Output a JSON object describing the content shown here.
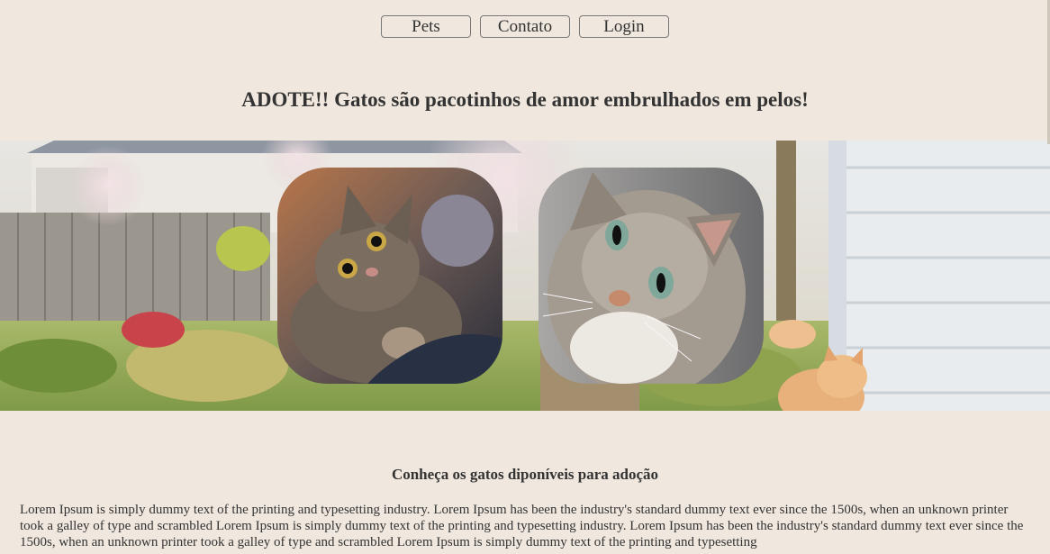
{
  "nav": {
    "items": [
      {
        "label": "Pets"
      },
      {
        "label": "Contato"
      },
      {
        "label": "Login"
      }
    ]
  },
  "hero": {
    "headline": "ADOTE!! Gatos são pacotinhos de amor embrulhados em pelos!"
  },
  "banner": {
    "images": [
      {
        "icon": "tabby-kitten-photo"
      },
      {
        "icon": "tabby-cat-closeup-photo"
      }
    ]
  },
  "section": {
    "title": "Conheça os gatos diponíveis para adoção",
    "body": "Lorem Ipsum is simply dummy text of the printing and typesetting industry. Lorem Ipsum has been the industry's standard dummy text ever since the 1500s, when an unknown printer took a galley of type and scrambled Lorem Ipsum is simply dummy text of the printing and typesetting industry. Lorem Ipsum has been the industry's standard dummy text ever since the 1500s, when an unknown printer took a galley of type and scrambled Lorem Ipsum is simply dummy text of the printing and typesetting"
  },
  "colors": {
    "background": "#f0e8de",
    "text": "#333333"
  }
}
